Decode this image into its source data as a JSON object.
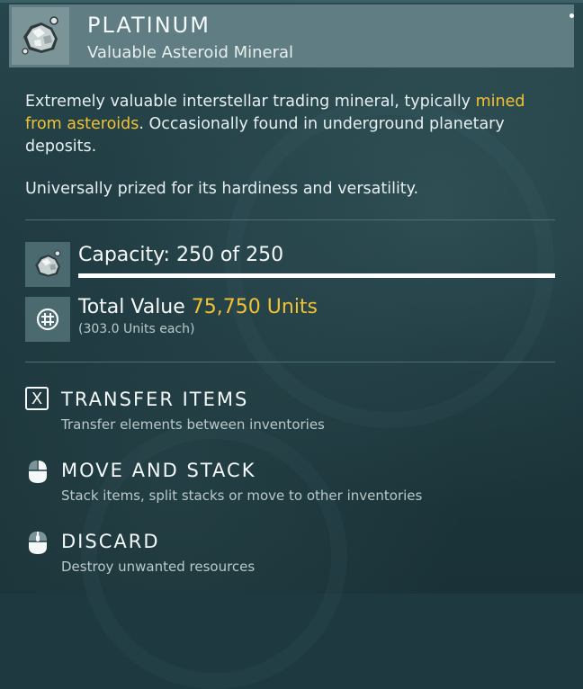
{
  "item": {
    "name": "PLATINUM",
    "category": "Valuable Asteroid Mineral",
    "icon": "platinum-ore-icon"
  },
  "description": {
    "part1": "Extremely valuable interstellar trading mineral, typically ",
    "highlight": "mined from asteroids",
    "part2": ". Occasionally found in underground planetary deposits.",
    "paragraph2": "Universally prized for its hardiness and versatility."
  },
  "capacity": {
    "label": "Capacity: 250 of 250",
    "current": 250,
    "max": 250
  },
  "value": {
    "label": "Total Value",
    "amount": "75,750 Units",
    "per_unit": "(303.0 Units each)",
    "icon": "units-currency-icon"
  },
  "actions": [
    {
      "key_icon": "x-key-icon",
      "title": "TRANSFER ITEMS",
      "description": "Transfer elements between inventories"
    },
    {
      "key_icon": "mouse-click-icon",
      "title": "MOVE AND STACK",
      "description": "Stack items, split stacks or move to other inventories"
    },
    {
      "key_icon": "mouse-click-icon",
      "title": "DISCARD",
      "description": "Destroy unwanted resources"
    }
  ],
  "colors": {
    "accent": "#f1c232",
    "header_bg": "#5f7d82",
    "panel_bg": "#1e3a40"
  }
}
